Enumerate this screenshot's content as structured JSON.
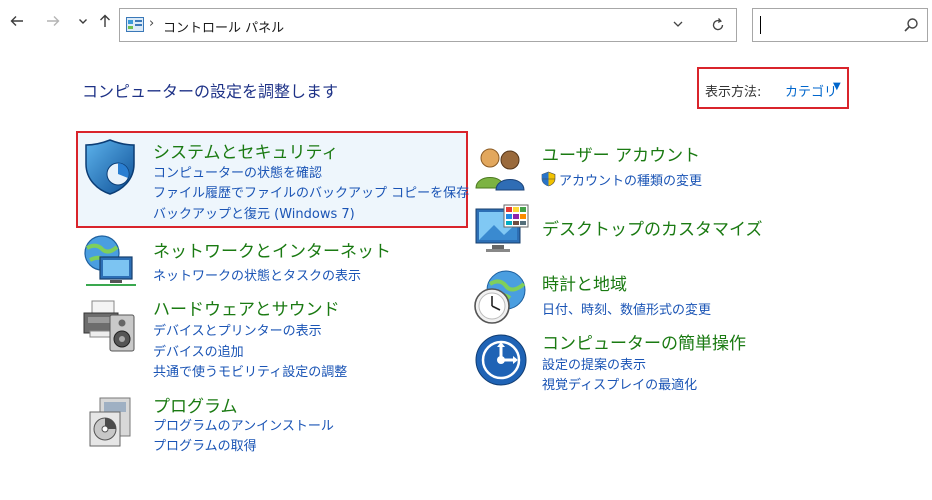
{
  "address_bar": {
    "path_separator": "›",
    "path": "コントロール パネル"
  },
  "search": {
    "placeholder": ""
  },
  "header": {
    "title": "コンピューターの設定を調整します",
    "view_by_label": "表示方法:",
    "view_by_value": "カテゴリ"
  },
  "categories": {
    "system": {
      "title": "システムとセキュリティ",
      "links": [
        "コンピューターの状態を確認",
        "ファイル履歴でファイルのバックアップ コピーを保存",
        "バックアップと復元 (Windows 7)"
      ]
    },
    "network": {
      "title": "ネットワークとインターネット",
      "links": [
        "ネットワークの状態とタスクの表示"
      ]
    },
    "hardware": {
      "title": "ハードウェアとサウンド",
      "links": [
        "デバイスとプリンターの表示",
        "デバイスの追加",
        "共通で使うモビリティ設定の調整"
      ]
    },
    "programs": {
      "title": "プログラム",
      "links": [
        "プログラムのアンインストール",
        "プログラムの取得"
      ]
    },
    "users": {
      "title": "ユーザー アカウント",
      "links": [
        "アカウントの種類の変更"
      ]
    },
    "appearance": {
      "title": "デスクトップのカスタマイズ",
      "links": []
    },
    "clock": {
      "title": "時計と地域",
      "links": [
        "日付、時刻、数値形式の変更"
      ]
    },
    "ease": {
      "title": "コンピューターの簡単操作",
      "links": [
        "設定の提案の表示",
        "視覚ディスプレイの最適化"
      ]
    }
  },
  "colors": {
    "category_title": "#1a7a12",
    "link": "#1a54b5",
    "highlight_border": "#d9242b"
  },
  "icons": {
    "back": "arrow-left-icon",
    "forward": "arrow-right-icon",
    "recent": "chevron-down-icon",
    "up": "arrow-up-icon",
    "refresh": "refresh-icon",
    "search": "magnifier-icon"
  }
}
